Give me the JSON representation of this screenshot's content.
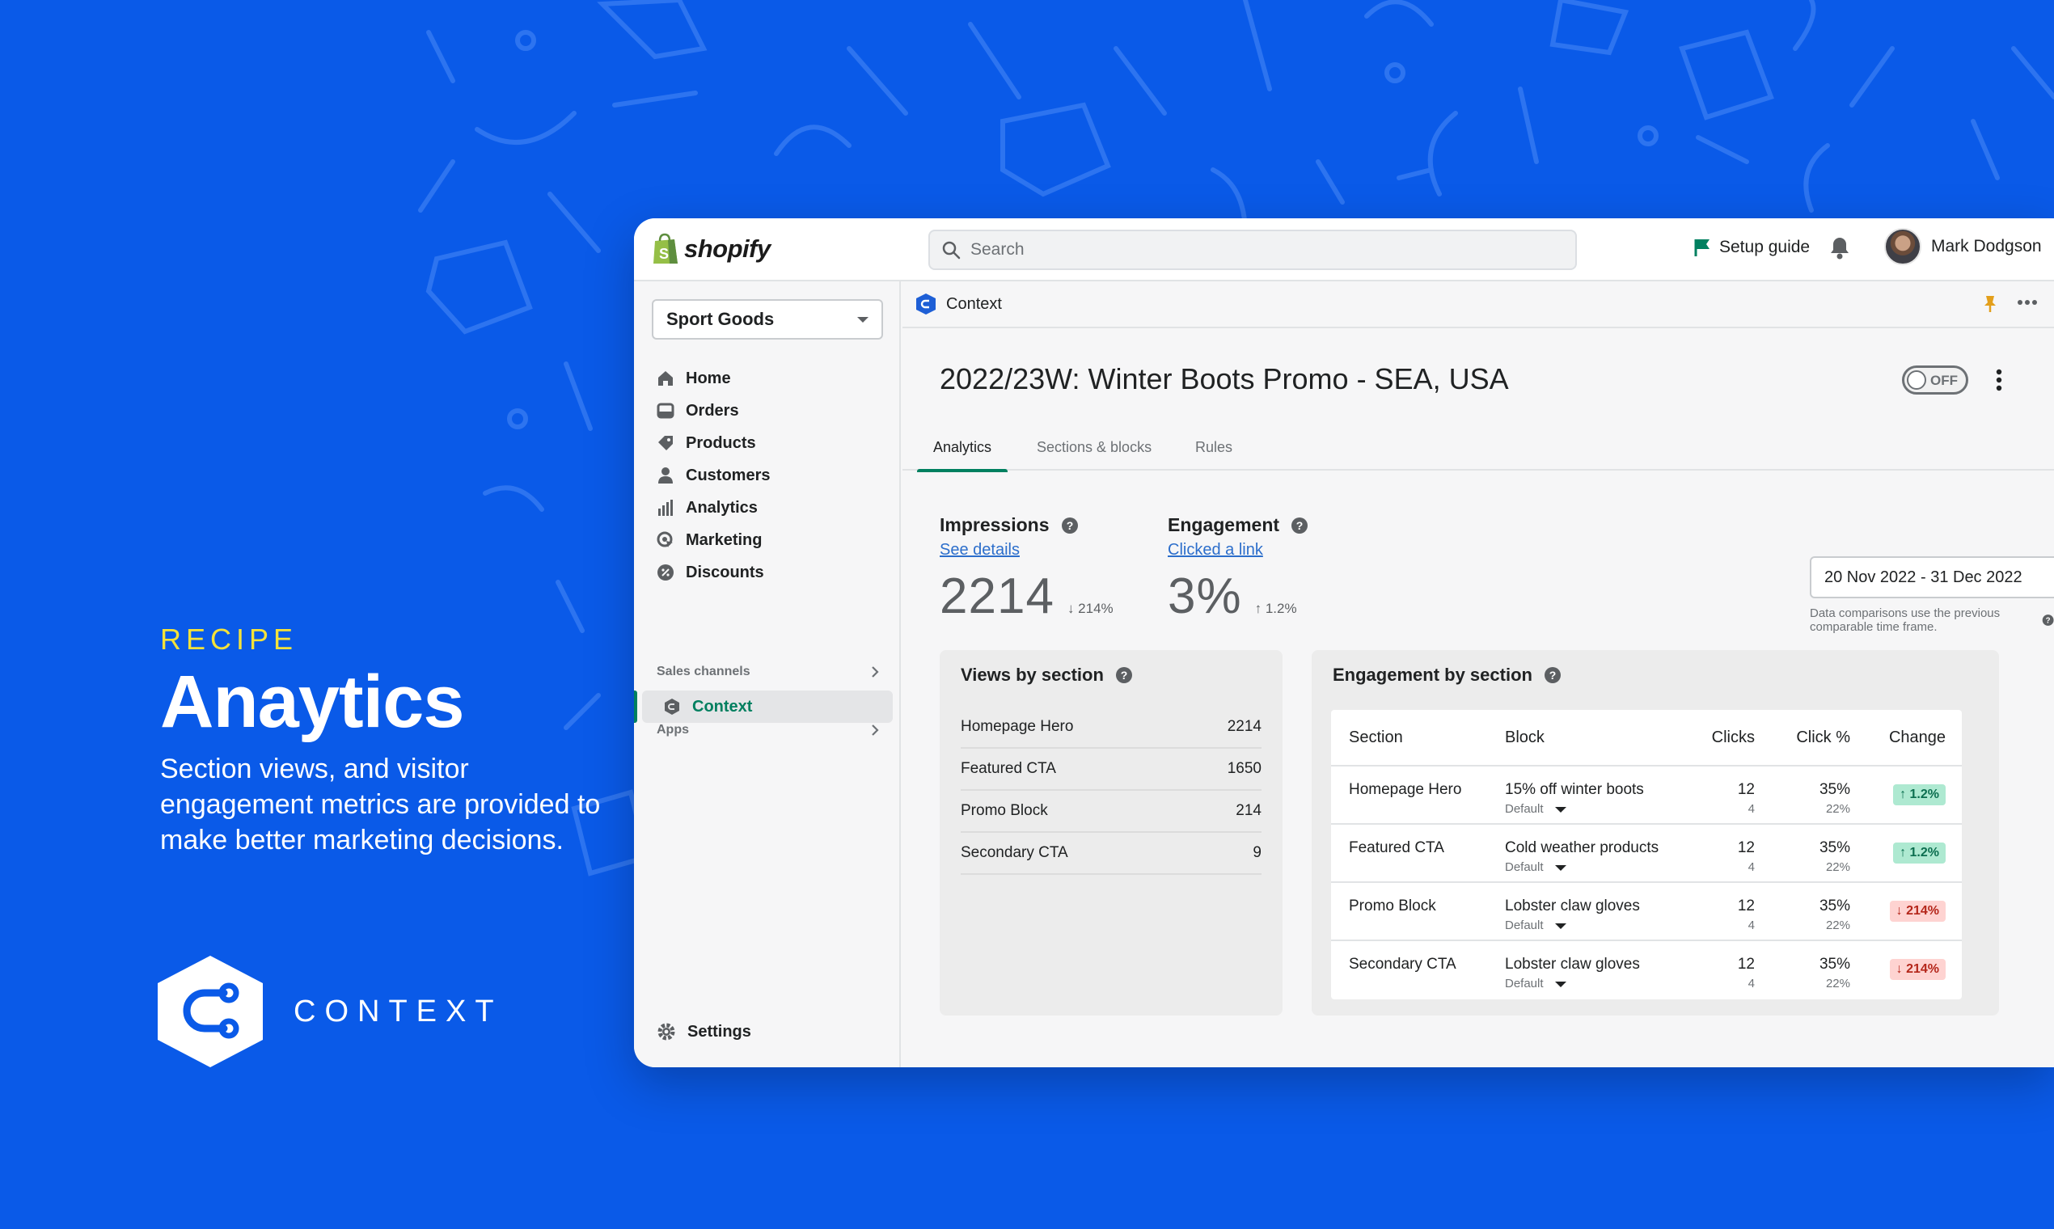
{
  "promo": {
    "kicker": "RECIPE",
    "headline": "Anaytics",
    "description": "Section views, and visitor engagement metrics are provided to make better marketing decisions.",
    "brand_word": "CONTEXT"
  },
  "colors": {
    "background": "#0a5ae8",
    "kicker": "#f4e23a",
    "accent_green": "#008060",
    "link_blue": "#2c6ecb"
  },
  "topbar": {
    "logo_text": "shopify",
    "search_placeholder": "Search",
    "setup_guide": "Setup guide",
    "user_name": "Mark Dodgson"
  },
  "sidebar": {
    "store": "Sport Goods",
    "items": [
      {
        "label": "Home",
        "icon": "home-icon"
      },
      {
        "label": "Orders",
        "icon": "orders-icon"
      },
      {
        "label": "Products",
        "icon": "tag-icon"
      },
      {
        "label": "Customers",
        "icon": "person-icon"
      },
      {
        "label": "Analytics",
        "icon": "bar-chart-icon"
      },
      {
        "label": "Marketing",
        "icon": "target-icon"
      },
      {
        "label": "Discounts",
        "icon": "discount-icon"
      }
    ],
    "sales_channels": "Sales channels",
    "apps": "Apps",
    "context_app": "Context",
    "settings": "Settings"
  },
  "appbar": {
    "app_name": "Context"
  },
  "page": {
    "title": "2022/23W: Winter Boots Promo - SEA, USA",
    "toggle_label": "OFF",
    "tabs": [
      "Analytics",
      "Sections & blocks",
      "Rules"
    ]
  },
  "metrics": {
    "impressions": {
      "title": "Impressions",
      "link": "See details",
      "value": "2214",
      "delta": "↓ 214%"
    },
    "engagement": {
      "title": "Engagement",
      "link": "Clicked a link",
      "value": "3%",
      "delta": "↑ 1.2%"
    }
  },
  "daterange": {
    "value": "20 Nov 2022 - 31 Dec 2022",
    "note": "Data comparisons use the previous comparable time frame."
  },
  "views_by_section": {
    "title": "Views by section",
    "rows": [
      {
        "section": "Homepage Hero",
        "views": "2214"
      },
      {
        "section": "Featured CTA",
        "views": "1650"
      },
      {
        "section": "Promo Block",
        "views": "214"
      },
      {
        "section": "Secondary CTA",
        "views": "9"
      }
    ]
  },
  "engagement_by_section": {
    "title": "Engagement by section",
    "headers": {
      "section": "Section",
      "block": "Block",
      "clicks": "Clicks",
      "click_pct": "Click %",
      "change": "Change"
    },
    "rows": [
      {
        "section": "Homepage Hero",
        "block": "15% off winter boots",
        "variant": "Default",
        "clicks": "12",
        "clicks_sub": "4",
        "pct": "35%",
        "pct_sub": "22%",
        "change": "↑ 1.2%",
        "trend": "up"
      },
      {
        "section": "Featured CTA",
        "block": "Cold weather products",
        "variant": "Default",
        "clicks": "12",
        "clicks_sub": "4",
        "pct": "35%",
        "pct_sub": "22%",
        "change": "↑ 1.2%",
        "trend": "up"
      },
      {
        "section": "Promo Block",
        "block": "Lobster claw gloves",
        "variant": "Default",
        "clicks": "12",
        "clicks_sub": "4",
        "pct": "35%",
        "pct_sub": "22%",
        "change": "↓ 214%",
        "trend": "down"
      },
      {
        "section": "Secondary CTA",
        "block": "Lobster claw gloves",
        "variant": "Default",
        "clicks": "12",
        "clicks_sub": "4",
        "pct": "35%",
        "pct_sub": "22%",
        "change": "↓ 214%",
        "trend": "down"
      }
    ]
  }
}
